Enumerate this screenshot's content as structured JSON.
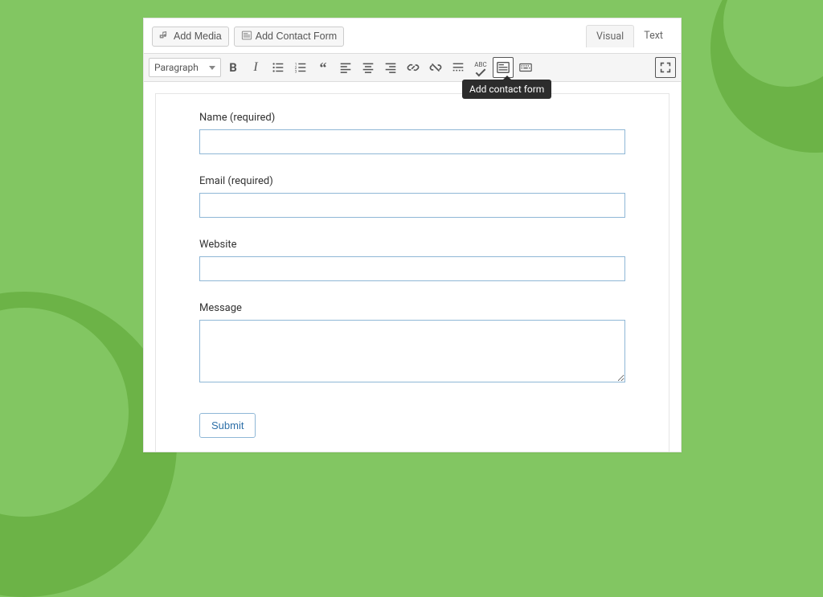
{
  "media_row": {
    "add_media": "Add Media",
    "add_contact_form": "Add Contact Form"
  },
  "tabs": {
    "visual": "Visual",
    "text": "Text",
    "active": "visual"
  },
  "toolbar": {
    "format_selector": "Paragraph",
    "tooltip": "Add contact form"
  },
  "form": {
    "fields": [
      {
        "label": "Name (required)",
        "type": "text",
        "value": ""
      },
      {
        "label": "Email (required)",
        "type": "text",
        "value": ""
      },
      {
        "label": "Website",
        "type": "text",
        "value": ""
      },
      {
        "label": "Message",
        "type": "textarea",
        "value": ""
      }
    ],
    "submit": "Submit"
  }
}
